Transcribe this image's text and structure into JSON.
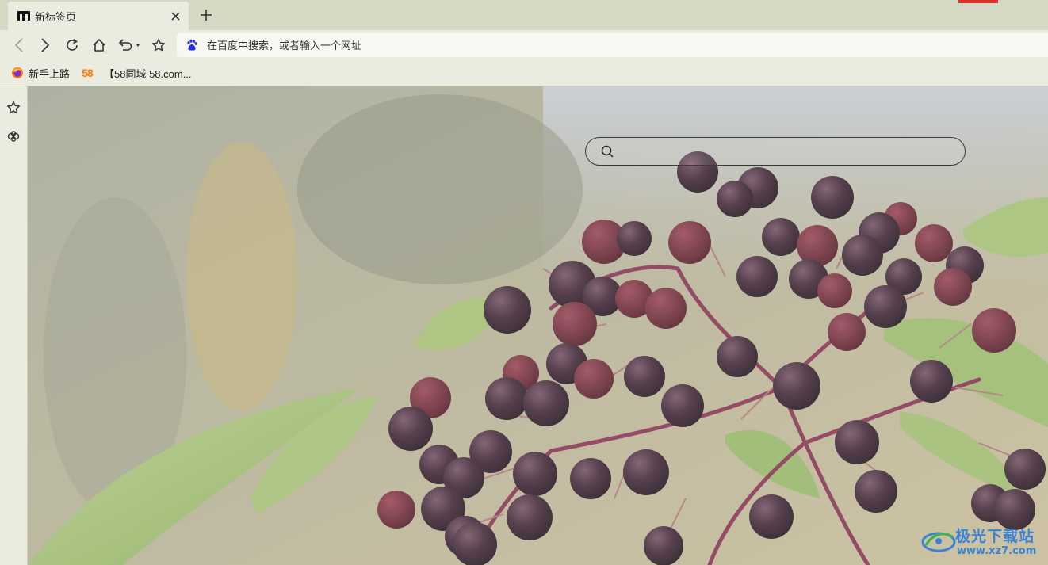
{
  "tab": {
    "title": "新标签页",
    "favicon": "browser-logo-icon",
    "close_icon": "close-icon"
  },
  "tabstrip": {
    "new_tab_icon": "plus-icon"
  },
  "toolbar": {
    "back_icon": "chevron-left-icon",
    "forward_icon": "chevron-right-icon",
    "reload_icon": "reload-icon",
    "home_icon": "home-icon",
    "undo_icon": "undo-icon",
    "favorite_icon": "star-icon"
  },
  "address_bar": {
    "placeholder": "在百度中搜索，或者输入一个网址",
    "search_engine_icon": "baidu-paw-icon"
  },
  "bookmarks": [
    {
      "label": "新手上路",
      "icon": "firefox-icon"
    },
    {
      "label": "",
      "icon": "58-logo"
    },
    {
      "label": "【58同城 58.com...",
      "icon": ""
    }
  ],
  "bookmark_58_logo_text": "58",
  "sidebar": [
    {
      "icon": "star-icon"
    },
    {
      "icon": "extension-puzzle-icon"
    }
  ],
  "newtab": {
    "search_icon": "search-icon",
    "search_placeholder": ""
  },
  "watermark": {
    "text": "极光下载站",
    "url": "www.xz7.com"
  },
  "colors": {
    "chrome_bg": "#e9ecdf",
    "tabstrip_bg": "#d3d9c3",
    "accent_red": "#d8302c",
    "watermark_blue": "#3a84d6"
  }
}
